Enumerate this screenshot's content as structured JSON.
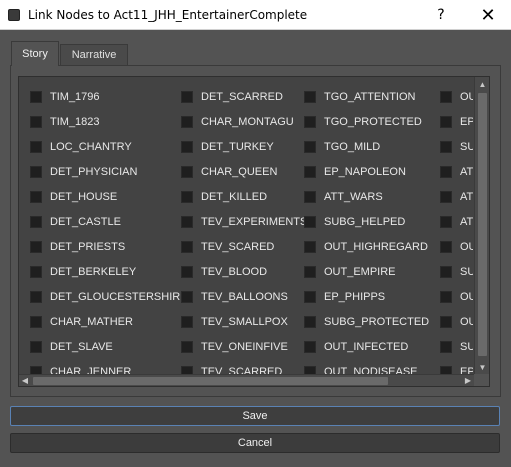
{
  "window": {
    "title": "Link Nodes to Act11_JHH_EntertainerComplete",
    "help_label": "?",
    "close_label": "✕"
  },
  "tabs": [
    {
      "label": "Story",
      "selected": true
    },
    {
      "label": "Narrative",
      "selected": false
    }
  ],
  "columns": [
    [
      "TIM_1796",
      "TIM_1823",
      "LOC_CHANTRY",
      "DET_PHYSICIAN",
      "DET_HOUSE",
      "DET_CASTLE",
      "DET_PRIESTS",
      "DET_BERKELEY",
      "DET_GLOUCESTERSHIRE",
      "CHAR_MATHER",
      "DET_SLAVE",
      "CHAR_JENNER"
    ],
    [
      "DET_SCARRED",
      "CHAR_MONTAGU",
      "DET_TURKEY",
      "CHAR_QUEEN",
      "DET_KILLED",
      "TEV_EXPERIMENTS",
      "TEV_SCARED",
      "TEV_BLOOD",
      "TEV_BALLOONS",
      "TEV_SMALLPOX",
      "TEV_ONEINFIVE",
      "TEV_SCARRED"
    ],
    [
      "TGO_ATTENTION",
      "TGO_PROTECTED",
      "TGO_MILD",
      "EP_NAPOLEON",
      "ATT_WARS",
      "SUBG_HELPED",
      "OUT_HIGHREGARD",
      "OUT_EMPIRE",
      "EP_PHIPPS",
      "SUBG_PROTECTED",
      "OUT_INFECTED",
      "OUT_NODISEASE"
    ],
    [
      "OU",
      "EP_",
      "SUI",
      "ATT",
      "ATT",
      "ATT",
      "OU",
      "SUI",
      "OU",
      "OU",
      "SUI",
      "EP_"
    ]
  ],
  "scrollbar": {
    "up_arrow": "▲",
    "down_arrow": "▼",
    "left_arrow": "◀",
    "right_arrow": "▶"
  },
  "buttons": {
    "save_label": "Save",
    "cancel_label": "Cancel"
  }
}
